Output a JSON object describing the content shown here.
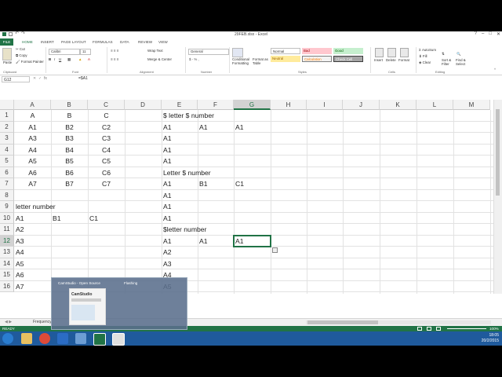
{
  "window": {
    "title": "29FEB.xlsx - Excel"
  },
  "ribbon_tabs": [
    "FILE",
    "HOME",
    "INSERT",
    "PAGE LAYOUT",
    "FORMULAS",
    "DATA",
    "REVIEW",
    "VIEW"
  ],
  "clipboard": {
    "cut": "Cut",
    "copy": "Copy",
    "format_painter": "Format Painter",
    "paste": "Paste",
    "label": "Clipboard"
  },
  "font": {
    "name": "Calibri",
    "size": "11",
    "label": "Font"
  },
  "alignment": {
    "wrap": "Wrap Text",
    "merge": "Merge & Center",
    "label": "Alignment"
  },
  "number": {
    "format": "General",
    "label": "Number"
  },
  "styles": {
    "conditional": "Conditional Formatting",
    "format_table": "Format as Table",
    "normal": "Normal",
    "bad": "Bad",
    "good": "Good",
    "neutral": "Neutral",
    "calculation": "Calculation",
    "check_cell": "Check Cell",
    "label": "Styles"
  },
  "cells_group": {
    "insert": "Insert",
    "delete": "Delete",
    "format": "Format",
    "label": "Cells"
  },
  "editing": {
    "autosum": "AutoSum",
    "fill": "Fill",
    "clear": "Clear",
    "sort": "Sort & Filter",
    "find": "Find & Select",
    "label": "Editing"
  },
  "formula_bar": {
    "name_box": "G12",
    "fx": "fx",
    "formula": "=$A1"
  },
  "columns": [
    "A",
    "B",
    "C",
    "D",
    "E",
    "F",
    "G",
    "H",
    "I",
    "J",
    "K",
    "L",
    "M"
  ],
  "rows": [
    "1",
    "2",
    "3",
    "4",
    "5",
    "6",
    "7",
    "8",
    "9",
    "10",
    "11",
    "12",
    "13",
    "14",
    "15",
    "16"
  ],
  "cells": {
    "A1": "A",
    "B1": "B",
    "C1": "C",
    "E1": "$ letter $ number",
    "A2": "A1",
    "B2": "B2",
    "C2": "C2",
    "E2": "A1",
    "F2": "A1",
    "G2": "A1",
    "A3": "A3",
    "B3": "B3",
    "C3": "C3",
    "E3": "A1",
    "A4": "A4",
    "B4": "B4",
    "C4": "C4",
    "E4": "A1",
    "A5": "A5",
    "B5": "B5",
    "C5": "C5",
    "E5": "A1",
    "A6": "A6",
    "B6": "B6",
    "C6": "C6",
    "E6": "Letter $ number",
    "A7": "A7",
    "B7": "B7",
    "C7": "C7",
    "E7": "A1",
    "F7": "B1",
    "G7": "C1",
    "E8": "A1",
    "A9": "letter number",
    "E9": "A1",
    "A10": "A1",
    "B10": "B1",
    "C10": "C1",
    "E10": "A1",
    "A11": "A2",
    "E11": "$letter number",
    "A12": "A3",
    "E12": "A1",
    "F12": "A1",
    "G12": "A1",
    "A13": "A4",
    "E13": "A2",
    "A14": "A5",
    "E14": "A3",
    "A15": "A6",
    "E15": "A4",
    "A16": "A7",
    "E16": "A5"
  },
  "sheet_tabs": [
    "Frequency"
  ],
  "status": {
    "ready": "READY",
    "zoom": "100%"
  },
  "taskbar_popup": {
    "title1": "CamStudio - Open Source",
    "title2": "Flashing",
    "thumb_text": "CamStudio"
  },
  "tray": {
    "time": "18:05",
    "date": "20/2/2015"
  },
  "colors": {
    "excel_green": "#217346",
    "taskbar": "#1f5a9c"
  }
}
